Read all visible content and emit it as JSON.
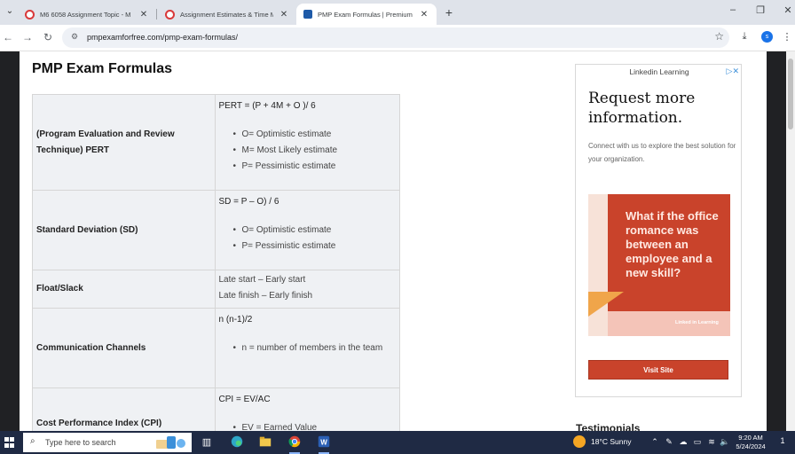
{
  "browser": {
    "tabs": [
      {
        "title": "M6 6058 Assignment Topic - M",
        "favicon": "canvas-icon"
      },
      {
        "title": "Assignment Estimates & Time M",
        "favicon": "canvas-icon"
      },
      {
        "title": "PMP Exam Formulas | Premium",
        "favicon": "pmp-icon"
      }
    ],
    "url": "pmpexamforfree.com/pmp-exam-formulas/",
    "profile_initial": "s"
  },
  "page": {
    "title": "PMP Exam Formulas",
    "rows": [
      {
        "name": "(Program Evaluation and Review Technique) PERT",
        "formula": "PERT = (P + 4M + O )/ 6",
        "items": [
          "O= Optimistic estimate",
          "M= Most Likely estimate",
          "P= Pessimistic estimate"
        ]
      },
      {
        "name": "Standard Deviation (SD)",
        "formula": "SD = P – O) / 6",
        "items": [
          "O= Optimistic estimate",
          "P= Pessimistic estimate"
        ]
      },
      {
        "name": "Float/Slack",
        "lines": [
          "Late start – Early start",
          "Late finish – Early finish"
        ]
      },
      {
        "name": "Communication Channels",
        "formula": "n (n-1)/2",
        "items": [
          "n = number of members in the team"
        ]
      },
      {
        "name": "Cost Performance Index (CPI)",
        "formula": "CPI = EV/AC",
        "items": [
          "EV = Earned Value"
        ]
      }
    ],
    "partial_heading": "Testimonials"
  },
  "ad": {
    "brand": "Linkedin Learning",
    "headline": "Request more information.",
    "body": "Connect with us to explore the best solution for your organization.",
    "quote": "What if the office romance was between an employee and a new skill?",
    "logo_text": "Linked in Learning",
    "cta": "Visit Site",
    "colors": {
      "accent": "#c9432b",
      "art_bg": "#f7e2d8"
    }
  },
  "taskbar": {
    "search_placeholder": "Type here to search",
    "weather": "18°C  Sunny",
    "time": "9:20 AM",
    "date": "5/24/2024",
    "notification_count": "1"
  }
}
